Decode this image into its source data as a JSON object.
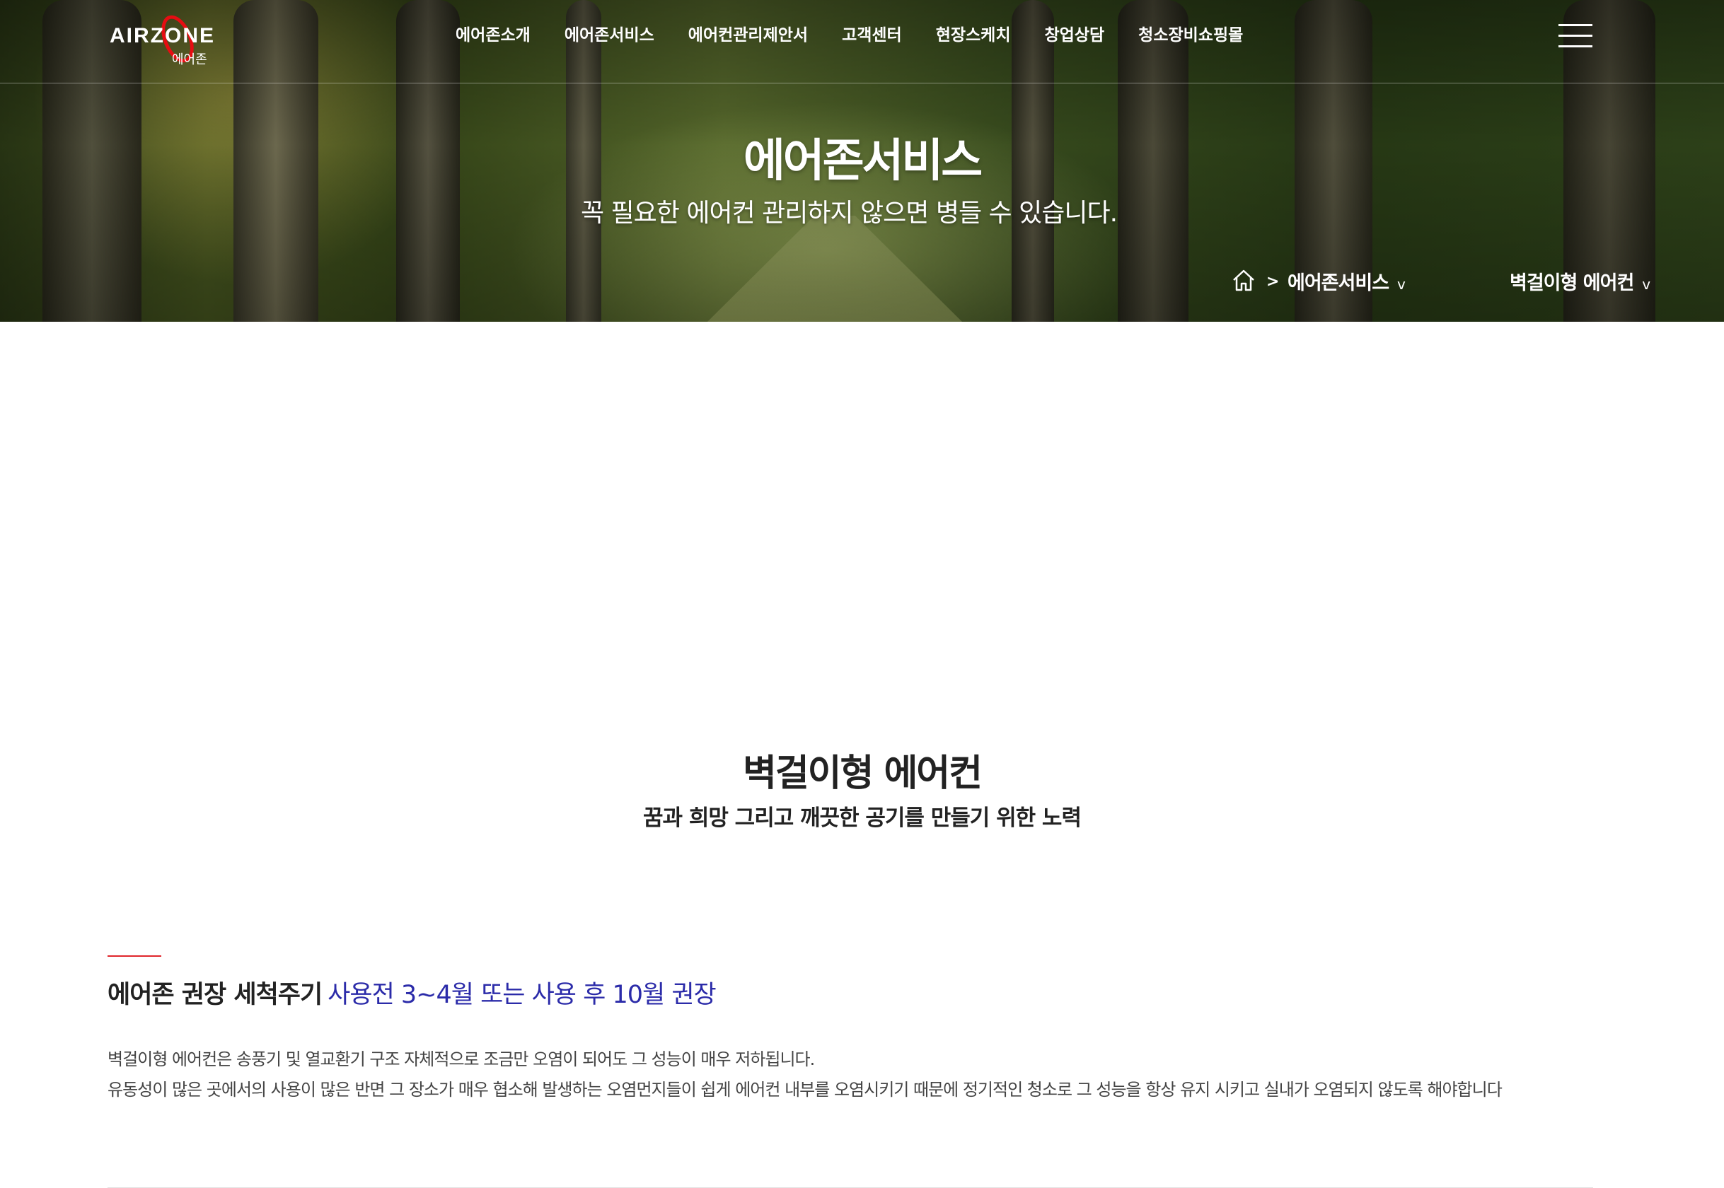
{
  "brand": {
    "logo_text": "AIRZONE",
    "logo_sub": "에어존",
    "accent_color": "#e60d12"
  },
  "nav": {
    "items": [
      {
        "label": "에어존소개"
      },
      {
        "label": "에어존서비스"
      },
      {
        "label": "에어컨관리제안서"
      },
      {
        "label": "고객센터"
      },
      {
        "label": "현장스케치"
      },
      {
        "label": "창업상담"
      },
      {
        "label": "청소장비쇼핑몰"
      }
    ],
    "menu_icon": "hamburger-icon"
  },
  "hero": {
    "title": "에어존서비스",
    "subtitle": "꼭 필요한 에어컨 관리하지 않으면 병들 수 있습니다."
  },
  "breadcrumb": {
    "home_icon": "home-icon",
    "separator": ">",
    "category": "에어존서비스",
    "current": "벽걸이형 에어컨",
    "caret": "v"
  },
  "main": {
    "title": "벽걸이형 에어컨",
    "subtitle": "꿈과 희망 그리고 깨끗한 공기를 만들기 위한 노력",
    "section": {
      "heading_dark": "에어존 권장 세척주기",
      "heading_blue": "사용전 3~4월 또는 사용 후 10월 권장",
      "heading_blue_color": "#2b2ba9",
      "paragraphs": [
        "벽걸이형 에어컨은 송풍기 및 열교환기 구조 자체적으로 조금만 오염이 되어도 그 성능이 매우 저하됩니다.",
        "유동성이 많은 곳에서의 사용이 많은 반면 그 장소가 매우 협소해 발생하는 오염먼지들이 쉽게 에어컨 내부를 오염시키기 때문에 정기적인 청소로 그 성능을 항상 유지 시키고 실내가 오염되지 않도록 해야합니다"
      ]
    }
  }
}
